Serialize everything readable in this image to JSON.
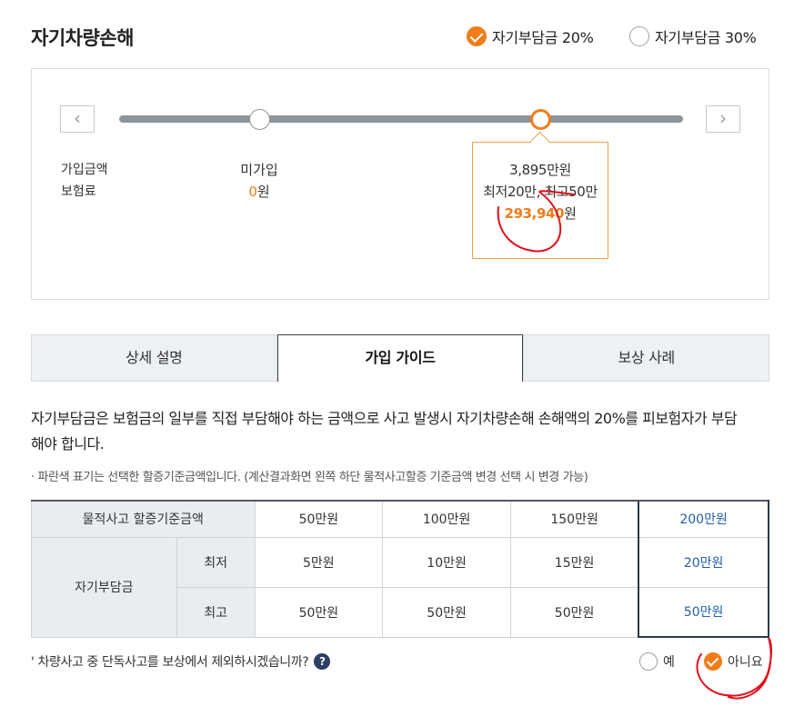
{
  "section_title": "자기차량손해",
  "deductible_options": [
    {
      "label": "자기부담금 20%",
      "selected": true
    },
    {
      "label": "자기부담금 30%",
      "selected": false
    }
  ],
  "slider": {
    "prev_icon": "chevron-left-icon",
    "next_icon": "chevron-right-icon",
    "row_labels": [
      "가입금액",
      "보험료"
    ],
    "not_joined": {
      "label": "미가입",
      "premium": "0",
      "unit": "원"
    },
    "selected_plan": {
      "amount": "3,895만원",
      "range": "최저20만, 최고50만",
      "premium": "293,940",
      "unit": "원"
    }
  },
  "tabs": [
    {
      "label": "상세 설명",
      "active": false
    },
    {
      "label": "가입 가이드",
      "active": true
    },
    {
      "label": "보상 사례",
      "active": false
    }
  ],
  "description": "자기부담금은 보험금의 일부를 직접 부담해야 하는 금액으로 사고 발생시 자기차량손해 손해액의 20%를 피보험자가 부담해야 합니다.",
  "note": "· 파란색 표기는 선택한 할증기준금액입니다. (계산결과화면 왼쪽 하단 물적사고할증 기준금액 변경 선택 시 변경 가능)",
  "table": {
    "header_label": "물적사고 할증기준금액",
    "columns": [
      "50만원",
      "100만원",
      "150만원",
      "200만원"
    ],
    "row_group_label": "자기부담금",
    "rows": [
      {
        "label": "최저",
        "values": [
          "5만원",
          "10만원",
          "15만원",
          "20만원"
        ]
      },
      {
        "label": "최고",
        "values": [
          "50만원",
          "50만원",
          "50만원",
          "50만원"
        ]
      }
    ]
  },
  "exclusion_question": {
    "text": "' 차량사고 중 단독사고를 보상에서 제외하시겠습니까?",
    "help_icon": "?",
    "options": [
      {
        "label": "예",
        "selected": false
      },
      {
        "label": "아니요",
        "selected": true
      }
    ]
  },
  "colors": {
    "accent": "#f07d1a",
    "highlight_blue": "#1f5fa8",
    "annotation_red": "#e0101a"
  }
}
